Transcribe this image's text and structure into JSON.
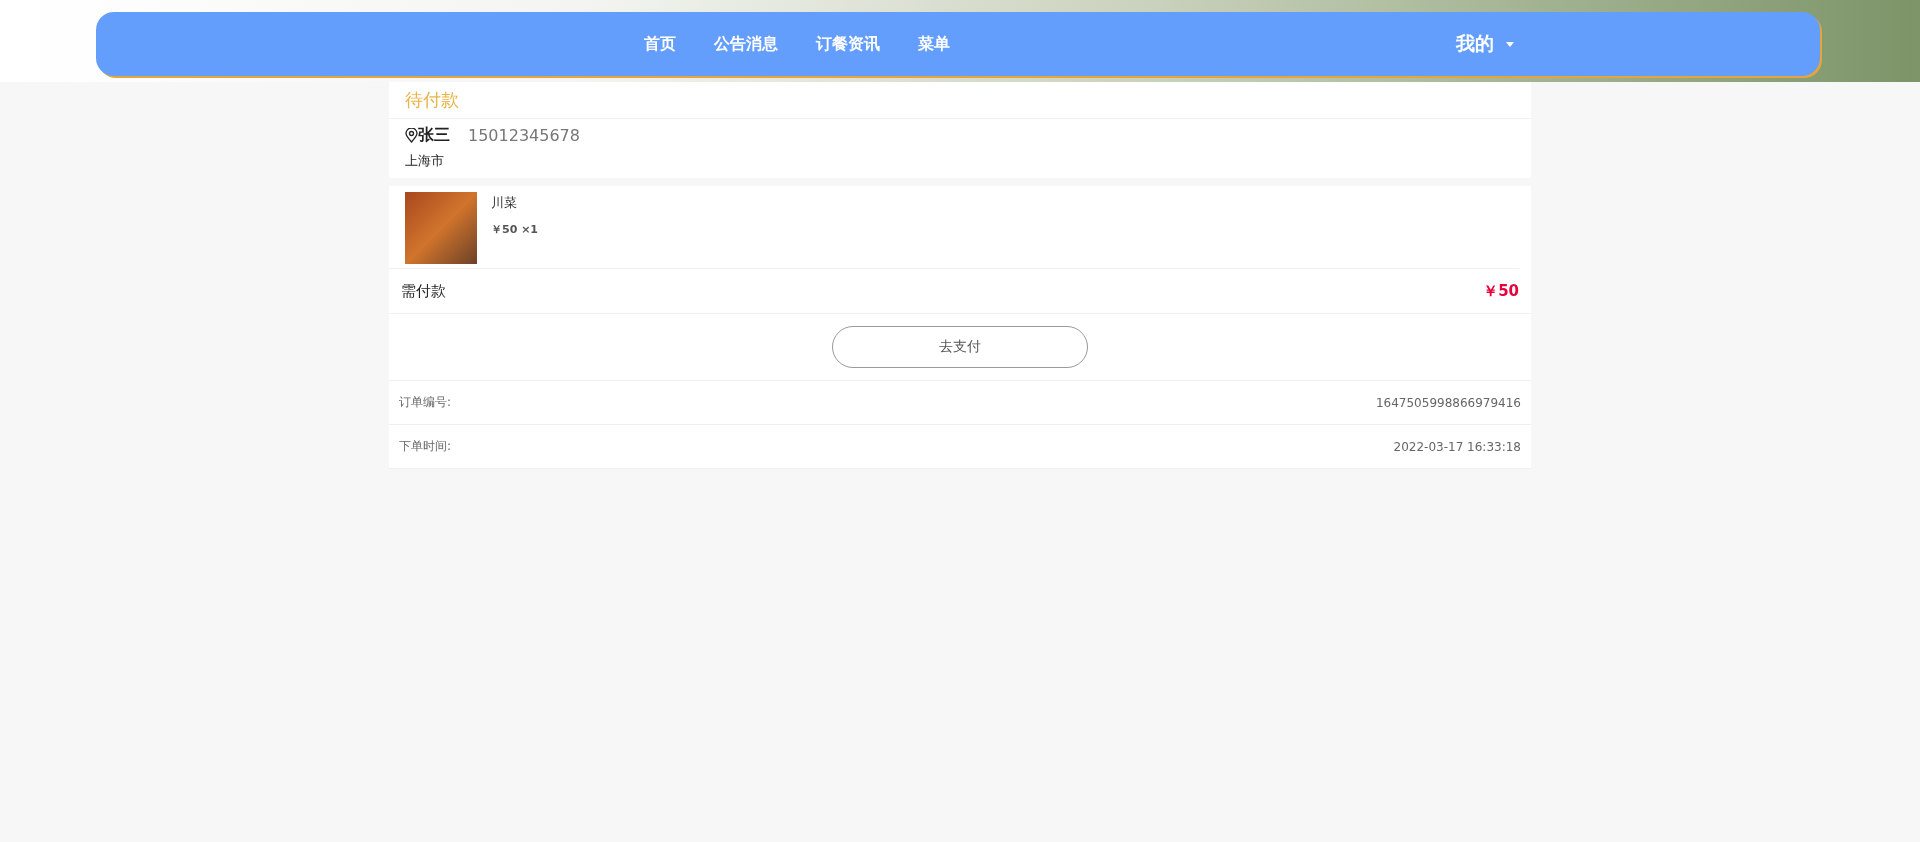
{
  "nav": {
    "items": [
      {
        "label": "首页"
      },
      {
        "label": "公告消息"
      },
      {
        "label": "订餐资讯"
      },
      {
        "label": "菜单"
      }
    ],
    "user_menu": {
      "label": "我的"
    }
  },
  "order": {
    "status": "待付款",
    "contact": {
      "name": "张三",
      "phone": "15012345678",
      "address": "上海市"
    },
    "items": [
      {
        "name": "川菜",
        "price": "￥50",
        "quantity": "×1"
      }
    ],
    "total": {
      "label": "需付款",
      "amount": "￥50"
    },
    "pay_button": "去支付",
    "details": [
      {
        "label": "订单编号:",
        "value": "1647505998866979416"
      },
      {
        "label": "下单时间:",
        "value": "2022-03-17 16:33:18"
      }
    ]
  }
}
